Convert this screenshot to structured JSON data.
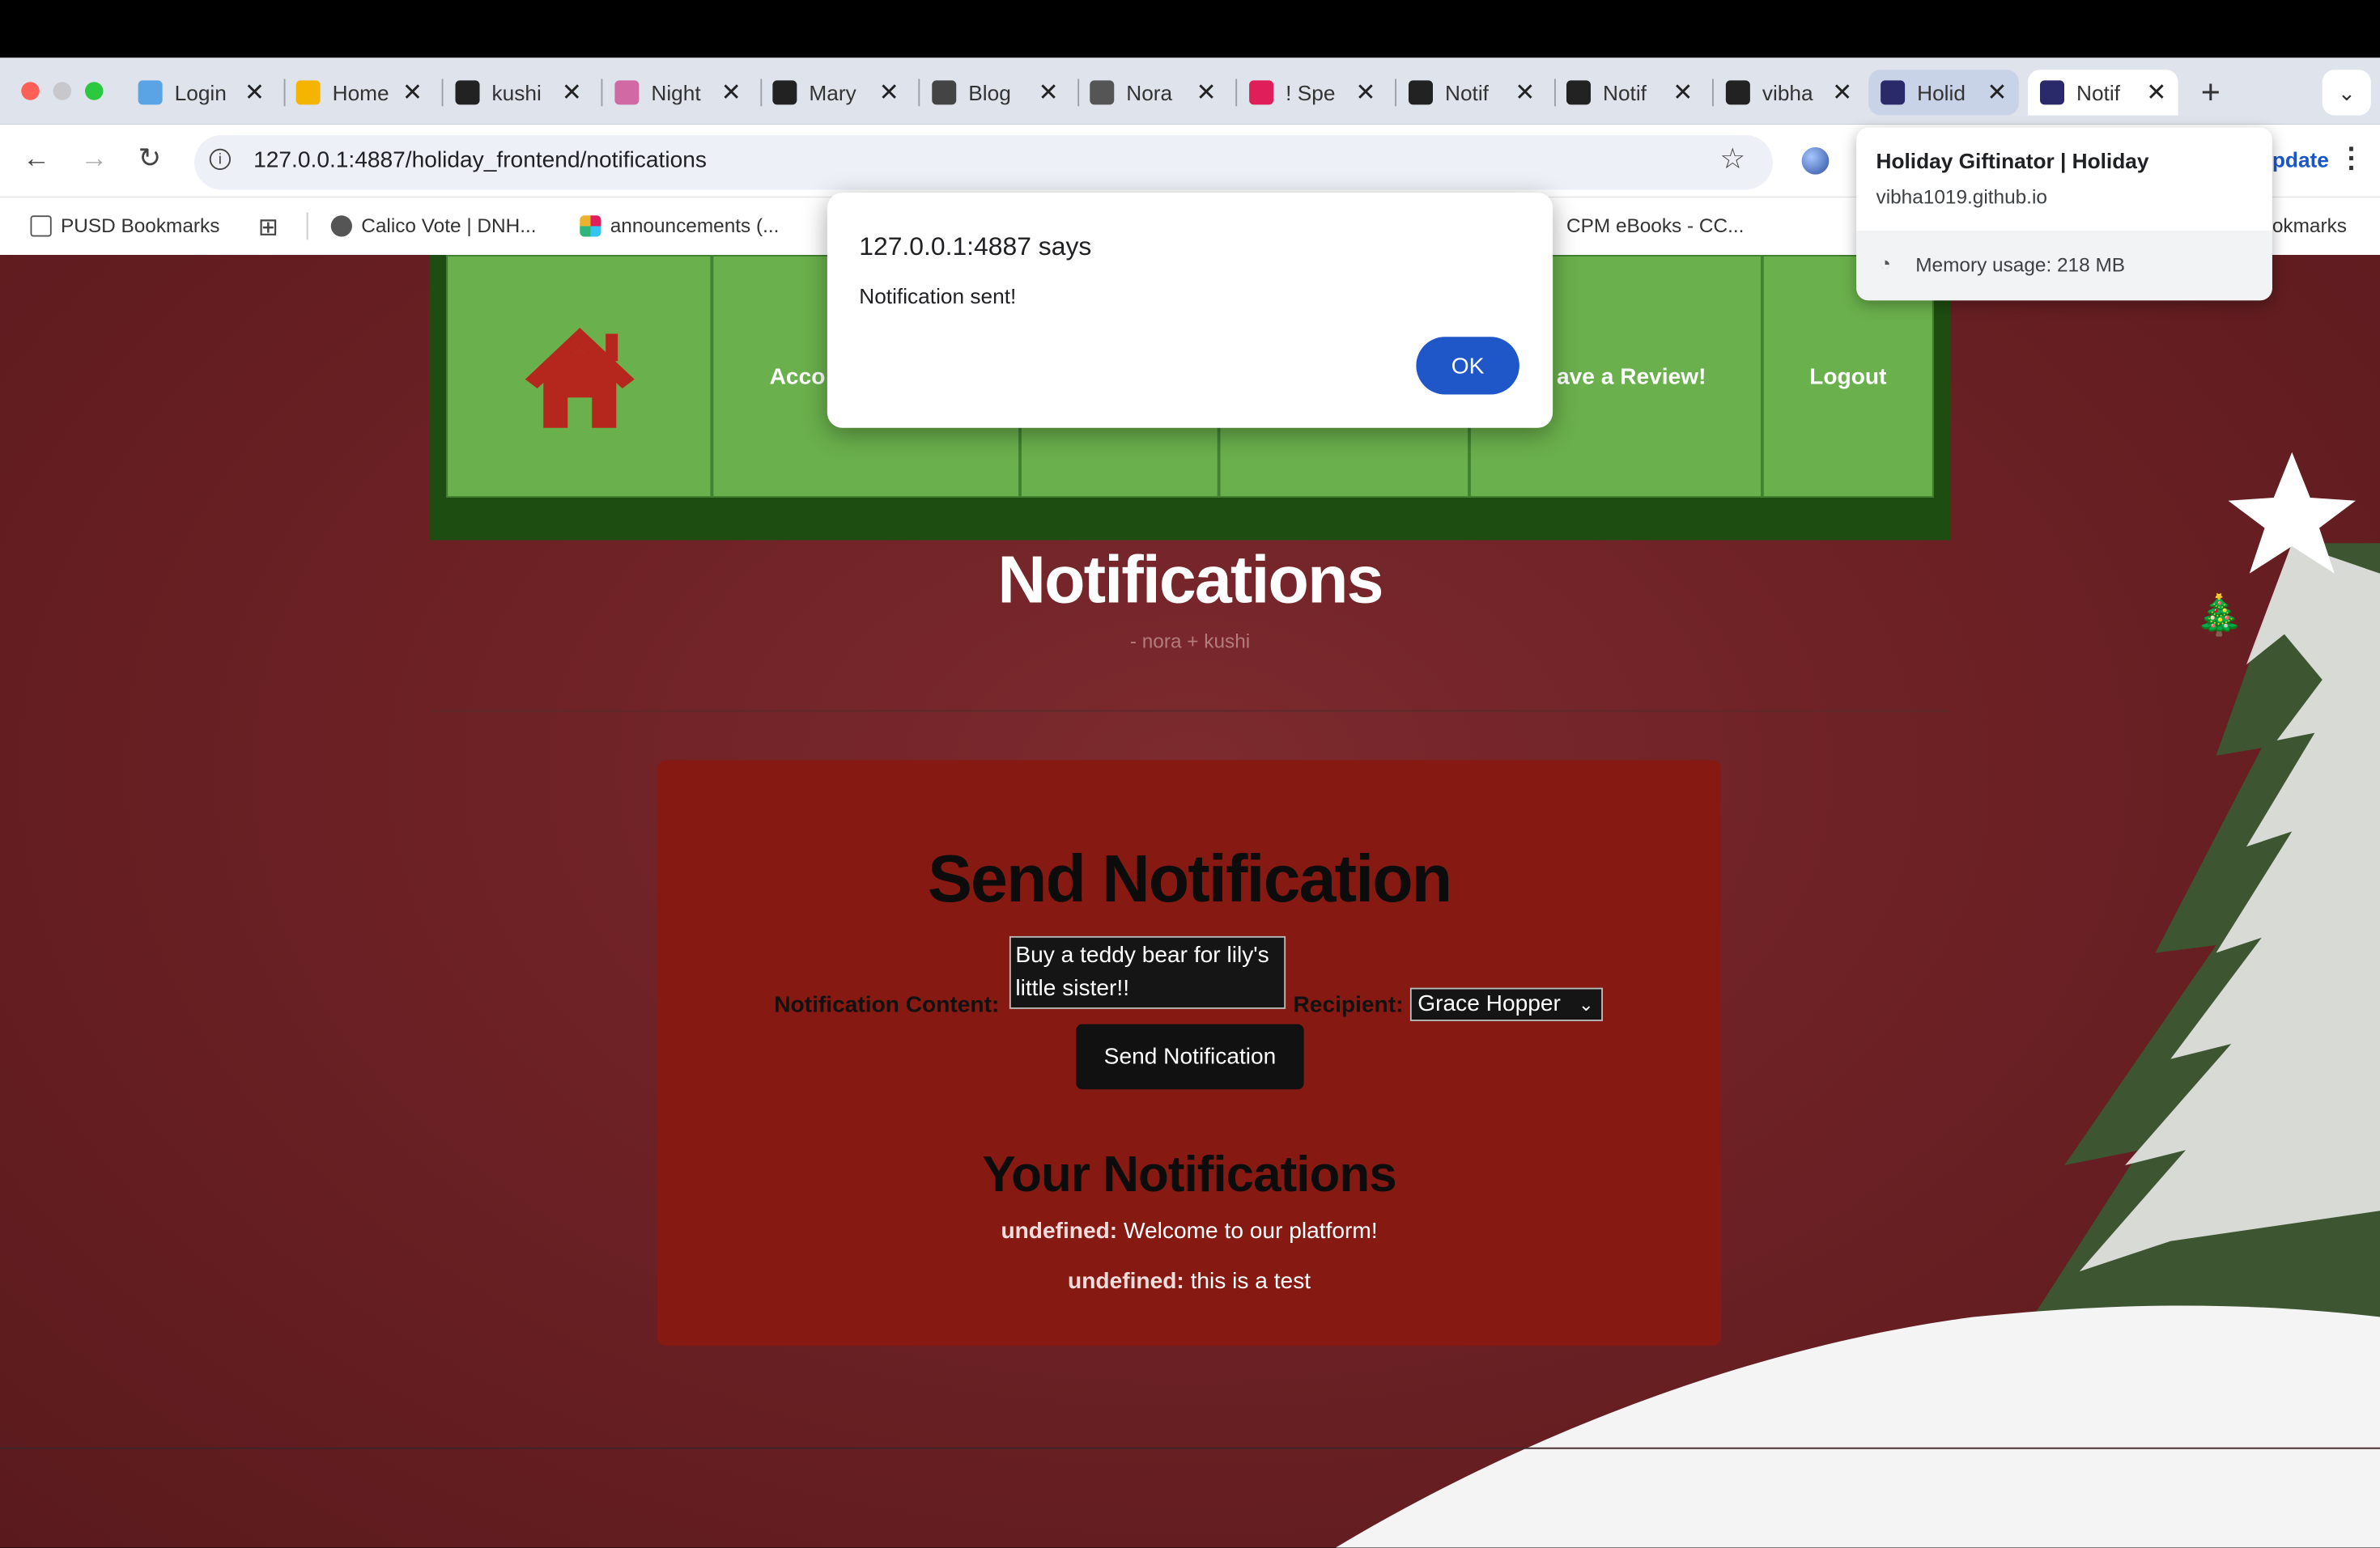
{
  "browser": {
    "tabs": [
      {
        "label": "Login",
        "color": "#5aa4e6"
      },
      {
        "label": "Home",
        "color": "#f4b400"
      },
      {
        "label": "kushi",
        "color": "#222222"
      },
      {
        "label": "Night",
        "color": "#d16aa4"
      },
      {
        "label": "Mary",
        "color": "#222222"
      },
      {
        "label": "Blog",
        "color": "#444444"
      },
      {
        "label": "Nora",
        "color": "#555555"
      },
      {
        "label": "! Spe",
        "color": "#e01e5a"
      },
      {
        "label": "Notif",
        "color": "#222222"
      },
      {
        "label": "Notif",
        "color": "#222222"
      },
      {
        "label": "vibha",
        "color": "#222222"
      },
      {
        "label": "Holid",
        "color": "#2a2a6a"
      },
      {
        "label": "Notif",
        "color": "#2a2a6a"
      }
    ],
    "url": "127.0.0.1:4887/holiday_frontend/notifications",
    "bookmarks": {
      "pusd": "PUSD Bookmarks",
      "calico": "Calico Vote | DNH...",
      "announcements": "announcements (...",
      "cpm": "CPM eBooks - CC...",
      "all": "okmarks"
    },
    "update_label": "pdate"
  },
  "hover_card": {
    "title": "Holiday Giftinator | Holiday",
    "domain": "vibha1019.github.io",
    "memory": "Memory usage: 218 MB"
  },
  "dialog": {
    "title": "127.0.0.1:4887 says",
    "message": "Notification sent!",
    "ok_label": "OK"
  },
  "navbar": {
    "account_label": "Acco",
    "review_label": "ave a Review!",
    "logout_label": "Logout",
    "home_color": "#b5271c"
  },
  "page": {
    "title": "Notifications",
    "subtitle": "- nora + kushi"
  },
  "form": {
    "title": "Send Notification",
    "content_label": "Notification Content:",
    "content_value": "Buy a teddy bear for lily's little sister!!",
    "recipient_label": "Recipient:",
    "recipient_value": "Grace Hopper",
    "send_label": "Send Notification"
  },
  "your_notifications": {
    "title": "Your Notifications",
    "items": [
      {
        "sender": "undefined:",
        "text": "Welcome to our platform!"
      },
      {
        "sender": "undefined:",
        "text": "this is a test"
      }
    ]
  }
}
